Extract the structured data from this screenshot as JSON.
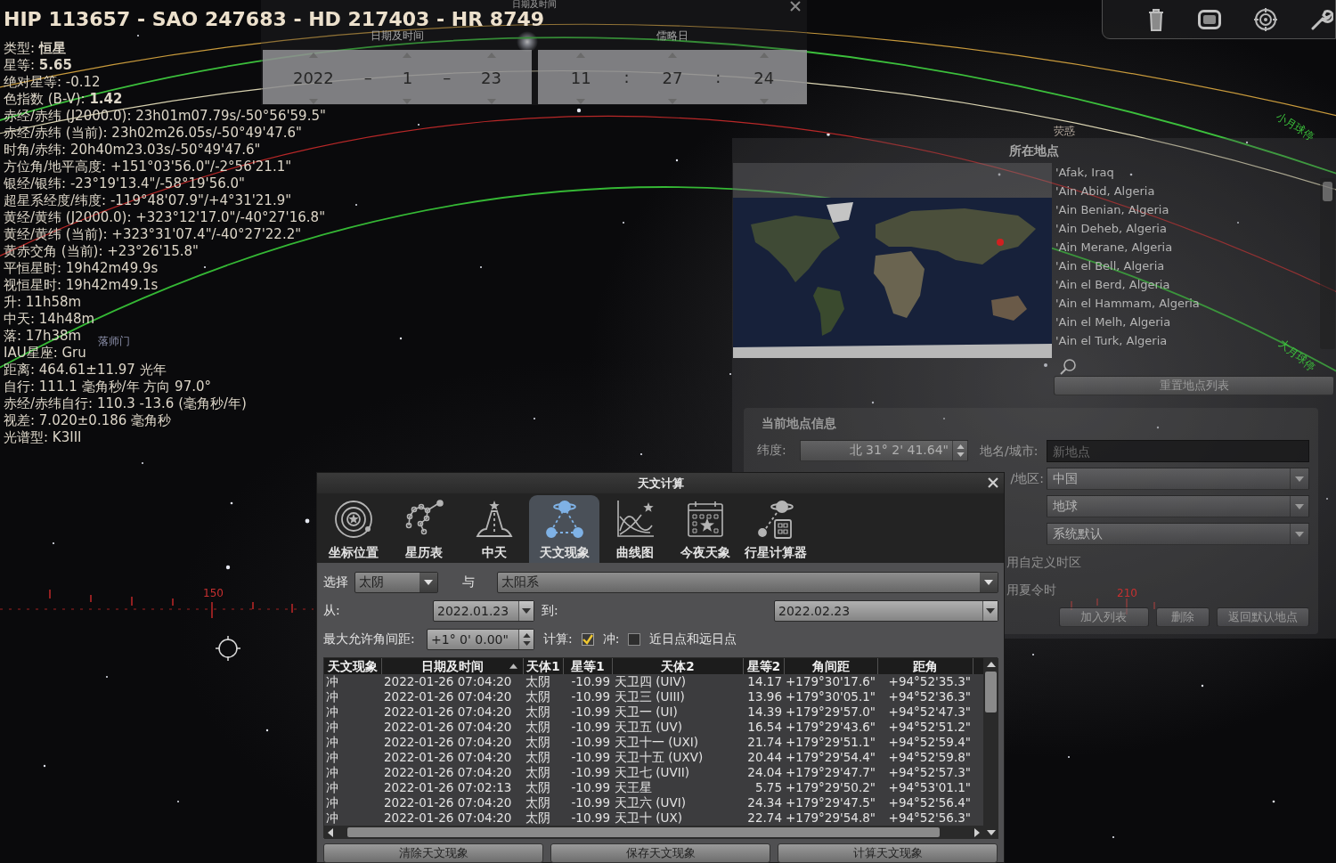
{
  "object_info": {
    "title": "HIP 113657 - SAO 247683 - HD 217403 - HR 8749",
    "lines": [
      "类型: **恒星**",
      "星等: **5.65**",
      "绝对星等: -0.12",
      "色指数 (B-V): **1.42**",
      "赤经/赤纬 (J2000.0): 23h01m07.79s/-50°56'59.5\"",
      "赤经/赤纬 (当前): 23h02m26.05s/-50°49'47.6\"",
      "时角/赤纬: 20h40m23.03s/-50°49'47.6\"",
      "方位角/地平高度: +151°03'56.0\"/-2°56'21.1\"",
      "银经/银纬: -23°19'13.4\"/-58°19'56.0\"",
      "超星系经度/纬度: -119°48'07.9\"/+4°31'21.9\"",
      "黄经/黄纬 (J2000.0): +323°12'17.0\"/-40°27'16.8\"",
      "黄经/黄纬 (当前): +323°31'07.4\"/-40°27'22.2\"",
      "黄赤交角 (当前): +23°26'15.8\"",
      "平恒星时: 19h42m49.9s",
      "视恒星时: 19h42m49.1s",
      "升: 11h58m",
      "中天: 14h48m",
      "落: 17h38m",
      "IAU星座: Gru",
      "距离: 464.61±11.97 光年",
      "自行: 111.1 毫角秒/年 方向 97.0°",
      "赤经/赤纬自行: 110.3 -13.6 (毫角秒/年)",
      "视差: 7.020±0.186 毫角秒",
      "光谱型: K3III"
    ]
  },
  "sky_labels": [
    {
      "text": "落师门",
      "kind": "star"
    },
    {
      "text": "荧惑",
      "kind": "planet"
    },
    {
      "text": "小月球停",
      "kind": "line"
    },
    {
      "text": "大月球停",
      "kind": "line"
    },
    {
      "text": "150",
      "kind": "scale"
    },
    {
      "text": "210",
      "kind": "scale"
    }
  ],
  "date_time_window": {
    "title": "日期及时间",
    "date_label": "日期及时间",
    "jd_label": "儒略日",
    "date_fields": [
      {
        "kind": "spin",
        "text": "2022"
      },
      {
        "kind": "separator",
        "text": "–"
      },
      {
        "kind": "spin",
        "text": "1"
      },
      {
        "kind": "separator",
        "text": "–"
      },
      {
        "kind": "spin",
        "text": "23"
      }
    ],
    "time_fields": [
      {
        "kind": "spin",
        "text": "11"
      },
      {
        "kind": "separator",
        "text": ":"
      },
      {
        "kind": "spin",
        "text": "27"
      },
      {
        "kind": "separator",
        "text": ":"
      },
      {
        "kind": "spin",
        "text": "24"
      }
    ]
  },
  "location_window": {
    "title": "所在地点",
    "cities": [
      {
        "name": "'Afak, Iraq",
        "selected": false
      },
      {
        "name": "'Ain Abid, Algeria",
        "selected": false
      },
      {
        "name": "'Ain Benian, Algeria",
        "selected": false
      },
      {
        "name": "'Ain Deheb, Algeria",
        "selected": false
      },
      {
        "name": "'Ain Merane, Algeria",
        "selected": false
      },
      {
        "name": "'Ain el Bell, Algeria",
        "selected": false
      },
      {
        "name": "'Ain el Berd, Algeria",
        "selected": false
      },
      {
        "name": "'Ain el Hammam, Algeria",
        "selected": false
      },
      {
        "name": "'Ain el Melh, Algeria",
        "selected": false
      },
      {
        "name": "'Ain el Turk, Algeria",
        "selected": false
      }
    ],
    "reset_button": "重置地点列表",
    "info": {
      "title": "当前地点信息",
      "latitude_label": "纬度:",
      "latitude": "北 31° 2' 41.64\"",
      "city_label": "地名/城市:",
      "city_placeholder": "新地点",
      "country_label": "/地区:",
      "country": "中国",
      "planet": "地球",
      "timezone": "系统默认",
      "custom_tz_label": "用自定义时区",
      "dst_label": "用夏令时"
    },
    "buttons": [
      "加入列表",
      "删除",
      "返回默认地点"
    ]
  },
  "calc_dialog": {
    "title": "天文计算",
    "tabs": [
      {
        "label": "坐标位置",
        "selected": false
      },
      {
        "label": "星历表",
        "selected": false
      },
      {
        "label": "中天",
        "selected": false
      },
      {
        "label": "天文现象",
        "selected": true
      },
      {
        "label": "曲线图",
        "selected": false
      },
      {
        "label": "今夜天象",
        "selected": false
      },
      {
        "label": "行星计算器",
        "selected": false
      }
    ],
    "select_label": "选择",
    "object1": "太阴",
    "with_label": "与",
    "object2": "太阳系",
    "from_label": "从:",
    "from_date": "2022.01.23",
    "to_label": "到:",
    "to_date": "2022.02.23",
    "max_sep_label": "最大允许角间距:",
    "max_sep": "+1° 0' 0.00\"",
    "options": [
      {
        "kind": "label",
        "text": "计算:"
      },
      {
        "kind": "checkbox",
        "checked": true
      },
      {
        "kind": "label",
        "text": "冲:"
      },
      {
        "kind": "checkbox",
        "checked": false
      },
      {
        "kind": "label",
        "text": "近日点和远日点"
      }
    ],
    "table": {
      "columns": [
        {
          "label": "天文现象",
          "sorted": false
        },
        {
          "label": "日期及时间",
          "sorted": true
        },
        {
          "label": "天体1",
          "sorted": false
        },
        {
          "label": "星等1",
          "sorted": false
        },
        {
          "label": "天体2",
          "sorted": false
        },
        {
          "label": "星等2",
          "sorted": false
        },
        {
          "label": "角间距",
          "sorted": false
        },
        {
          "label": "距角",
          "sorted": false
        }
      ],
      "rows": [
        [
          "冲",
          "2022-01-26 07:04:20",
          "太阴",
          "-10.99",
          "天卫四 (UIV)",
          "14.17",
          "+179°30'17.6\"",
          "+94°52'35.3\""
        ],
        [
          "冲",
          "2022-01-26 07:04:20",
          "太阴",
          "-10.99",
          "天卫三 (UIII)",
          "13.96",
          "+179°30'05.1\"",
          "+94°52'36.3\""
        ],
        [
          "冲",
          "2022-01-26 07:04:20",
          "太阴",
          "-10.99",
          "天卫一 (UI)",
          "14.39",
          "+179°29'57.0\"",
          "+94°52'47.3\""
        ],
        [
          "冲",
          "2022-01-26 07:04:20",
          "太阴",
          "-10.99",
          "天卫五 (UV)",
          "16.54",
          "+179°29'43.6\"",
          "+94°52'51.2\""
        ],
        [
          "冲",
          "2022-01-26 07:04:20",
          "太阴",
          "-10.99",
          "天卫十一 (UXI)",
          "21.74",
          "+179°29'51.1\"",
          "+94°52'59.4\""
        ],
        [
          "冲",
          "2022-01-26 07:04:20",
          "太阴",
          "-10.99",
          "天卫十五 (UXV)",
          "20.44",
          "+179°29'54.4\"",
          "+94°52'59.8\""
        ],
        [
          "冲",
          "2022-01-26 07:04:20",
          "太阴",
          "-10.99",
          "天卫七 (UVII)",
          "24.04",
          "+179°29'47.7\"",
          "+94°52'57.3\""
        ],
        [
          "冲",
          "2022-01-26 07:02:13",
          "太阴",
          "-10.99",
          "天王星",
          "5.75",
          "+179°29'50.2\"",
          "+94°53'01.1\""
        ],
        [
          "冲",
          "2022-01-26 07:04:20",
          "太阴",
          "-10.99",
          "天卫六 (UVI)",
          "24.34",
          "+179°29'47.5\"",
          "+94°52'56.4\""
        ],
        [
          "冲",
          "2022-01-26 07:04:20",
          "太阴",
          "-10.99",
          "天卫十 (UX)",
          "22.74",
          "+179°29'54.8\"",
          "+94°52'56.3\""
        ]
      ]
    },
    "buttons": [
      "清除天文现象",
      "保存天文现象",
      "计算天文现象"
    ]
  }
}
